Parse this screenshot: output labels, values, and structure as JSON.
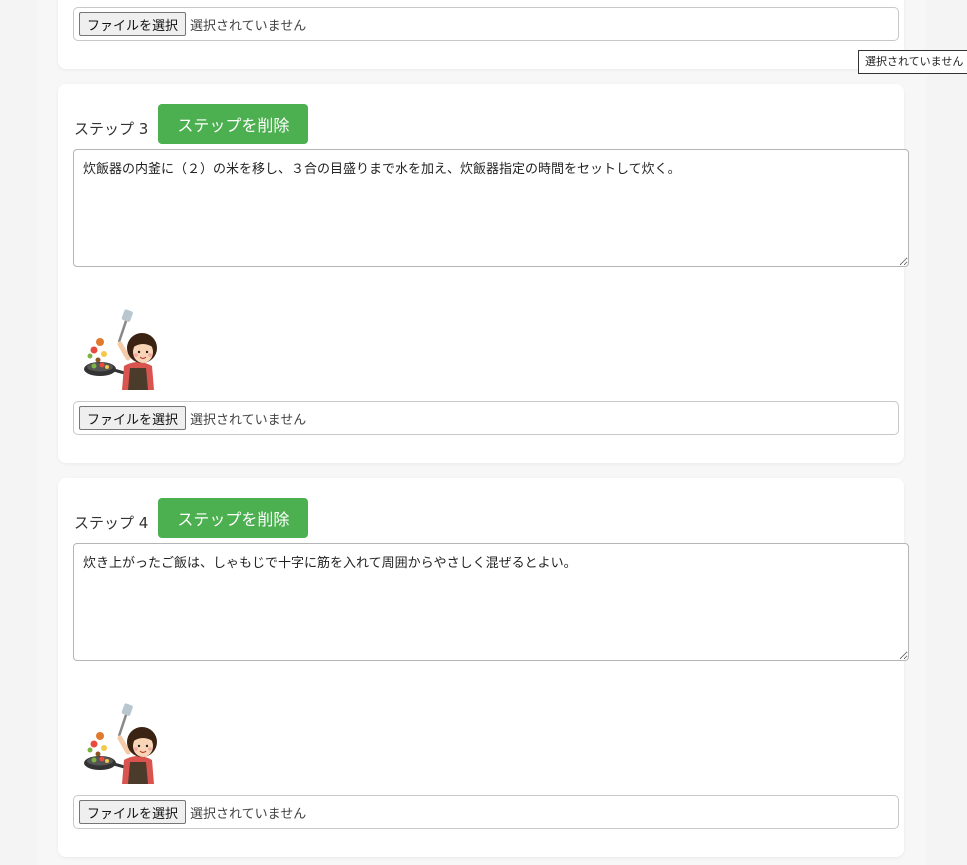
{
  "file_input": {
    "button_label": "ファイルを選択",
    "status": "選択されていません"
  },
  "tooltip": {
    "text": "選択されていません"
  },
  "steps": [
    {
      "label": "ステップ 3",
      "delete_label": "ステップを削除",
      "text": "炊飯器の内釜に（２）の米を移し、３合の目盛りまで水を加え、炊飯器指定の時間をセットして炊く。",
      "image_icon": "cooking-woman-illustration"
    },
    {
      "label": "ステップ 4",
      "delete_label": "ステップを削除",
      "text": "炊き上がったご飯は、しゃもじで十字に筋を入れて周囲からやさしく混ぜるとよい。",
      "image_icon": "cooking-woman-illustration"
    }
  ],
  "colors": {
    "accent": "#4caf50",
    "background": "#f4f4f4",
    "card": "#ffffff"
  }
}
